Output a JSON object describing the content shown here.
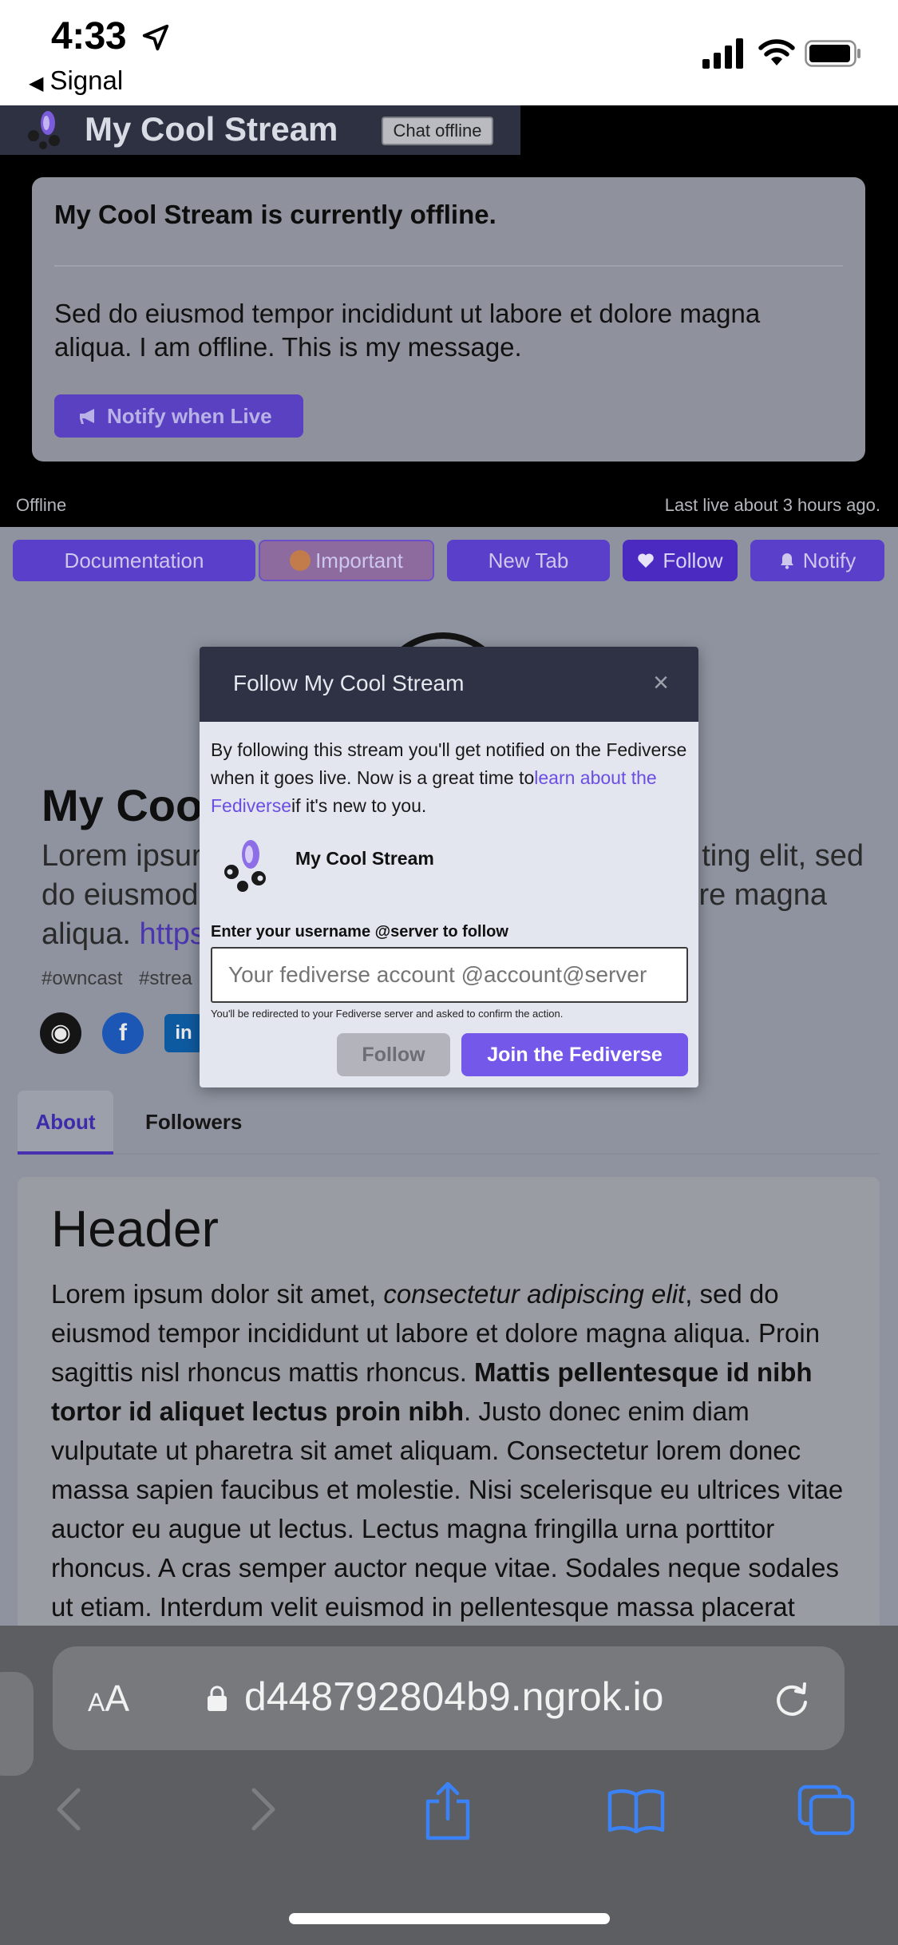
{
  "status_bar": {
    "time": "4:33",
    "back_app": "Signal",
    "icons": [
      "location-arrow-icon",
      "cellular-signal-icon",
      "wifi-icon",
      "battery-icon"
    ]
  },
  "header": {
    "title": "My Cool Stream",
    "chat_status": "Chat offline"
  },
  "offline": {
    "title": "My Cool Stream is currently offline.",
    "message": "Sed do eiusmod tempor incididunt ut labore et dolore magna aliqua. I am offline. This is my message.",
    "notify_button": "Notify when Live",
    "status_left": "Offline",
    "status_right": "Last live about 3 hours ago."
  },
  "actions": {
    "documentation": "Documentation",
    "important": "Important",
    "new_tab": "New Tab",
    "follow": "Follow",
    "notify": "Notify"
  },
  "profile": {
    "name": "My Coo",
    "bio_line1_left": "Lorem ipsur",
    "bio_line1_right": "ting elit, sed",
    "bio_line2_left": "do eiusmod",
    "bio_line2_right": "re magna",
    "bio_line3_left": "aliqua.",
    "bio_link": "https",
    "tags": "#owncast  #strea",
    "social": [
      "github-icon",
      "facebook-icon",
      "linkedin-icon"
    ]
  },
  "tabs": {
    "about": "About",
    "followers": "Followers"
  },
  "content": {
    "header": "Header",
    "p1": "Lorem ipsum dolor sit amet, ",
    "p1_em": "consectetur adipiscing elit",
    "p2": ", sed do eiusmod tempor incididunt ut labore et dolore magna aliqua. Proin sagittis nisl rhoncus mattis rhoncus. ",
    "p2_strong": "Mattis pellentesque id nibh tortor id aliquet lectus proin nibh",
    "p3": ". Justo donec enim diam vulputate ut pharetra sit amet aliquam. Consectetur lorem donec massa sapien faucibus et molestie. Nisi scelerisque eu ultrices vitae auctor eu augue ut lectus. Lectus magna fringilla urna porttitor rhoncus. A cras semper auctor neque vitae. Sodales neque sodales ut etiam. Interdum velit euismod in pellentesque massa placerat"
  },
  "modal": {
    "title": "Follow My Cool Stream",
    "close": "×",
    "text_before": "By following this stream you'll get notified on the Fediverse when it goes live. Now is a great time to",
    "text_link": "learn about the Fediverse",
    "text_after": "if it's new to you.",
    "account_name": "My Cool Stream",
    "input_label": "Enter your username @server to follow",
    "input_placeholder": "Your fediverse account @account@server",
    "note": "You'll be redirected to your Fediverse server and asked to confirm the action.",
    "follow_button": "Follow",
    "join_button": "Join the Fediverse"
  },
  "browser": {
    "aa_small": "A",
    "aa_large": "A",
    "url": "d448792804b9.ngrok.io"
  },
  "colors": {
    "accent": "#7358ea",
    "brand_dark": "#2e3244",
    "button_purple": "#5a3fcb"
  }
}
